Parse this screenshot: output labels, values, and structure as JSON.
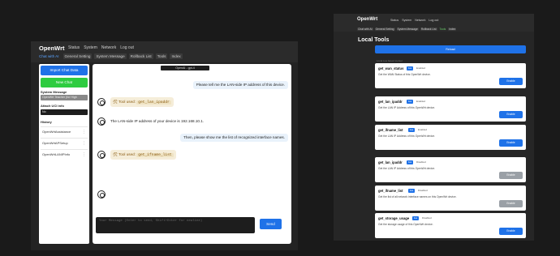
{
  "left": {
    "brand": "OpenWrt",
    "menu": [
      "Status",
      "System",
      "Network",
      "Log out"
    ],
    "tabs": [
      "Chat with AI",
      "General Setting",
      "System Message",
      "Rollback List",
      "Tools",
      "Index"
    ],
    "sidebar": {
      "import_button": "Import Chat Data",
      "new_chat_button": "New Chat",
      "system_message_label": "System Message",
      "system_message_value": "OpenWrt Teacher (for High",
      "attach_label": "Attach UCI info",
      "attach_value": "No",
      "history_label": "History",
      "history": [
        "OpenWrtAssistance",
        "OpenWrtAPSetup",
        "OpenWrtLANIPInfo"
      ]
    },
    "chat": {
      "title": "OpenAI - gpt-4",
      "msg1": "Please tell me the LAN-side IP address of this device.",
      "tool_prefix": "Tool used:",
      "tool1": "get_lan_ipaddr",
      "reply1": "The LAN-side IP address of your device is 192.168.10.1.",
      "msg2": "Then, please show me the list of recognized interface names.",
      "tool2": "get_ifname_list",
      "input_placeholder": "Your Message (Enter to send, Shift+Enter for newline)",
      "send_button": "Send"
    }
  },
  "right": {
    "brand": "OpenWrt",
    "menu": [
      "Status",
      "System",
      "Network",
      "Log out"
    ],
    "tabs": [
      "Chat with AI",
      "General Setting",
      "System Message",
      "Rollback List",
      "Tools",
      "Index"
    ],
    "title": "Local Tools",
    "reload_button": "Reload",
    "subtitle": "Local Lua based toolset",
    "cards": [
      {
        "name": "get_wan_status",
        "badge": "lua",
        "status": "Enabled",
        "desc": "Get the WAN Status of this OpenWrt device.",
        "button": "Enable",
        "color": "#1f72e8"
      },
      {
        "name": "get_lan_ipaddr",
        "badge": "lua",
        "status": "Enabled",
        "desc": "Get the LAN IP Address of this OpenWrt device.",
        "button": "Enable",
        "color": "#1f72e8"
      },
      {
        "name": "get_ifname_list",
        "badge": "lua",
        "status": "Enabled",
        "desc": "Get the LAN IP Address of this OpenWrt device.",
        "button": "Enable",
        "color": "#1f72e8"
      },
      {
        "name": "get_lan_ipaddr",
        "badge": "lua",
        "status": "Disabled",
        "desc": "Get the LAN IP Address of this OpenWrt device.",
        "button": "Enable",
        "color": "#9aa0a6"
      },
      {
        "name": "get_ifname_list",
        "badge": "lua",
        "status": "Disabled",
        "desc": "Get the list of all network interface names on this OpenWrt device.",
        "button": "Enable",
        "color": "#9aa0a6"
      },
      {
        "name": "get_storage_usage",
        "badge": "lua",
        "status": "Disabled",
        "desc": "Get the storage usage of this OpenWrt device.",
        "button": "Enable",
        "color": "#1f72e8"
      }
    ]
  }
}
